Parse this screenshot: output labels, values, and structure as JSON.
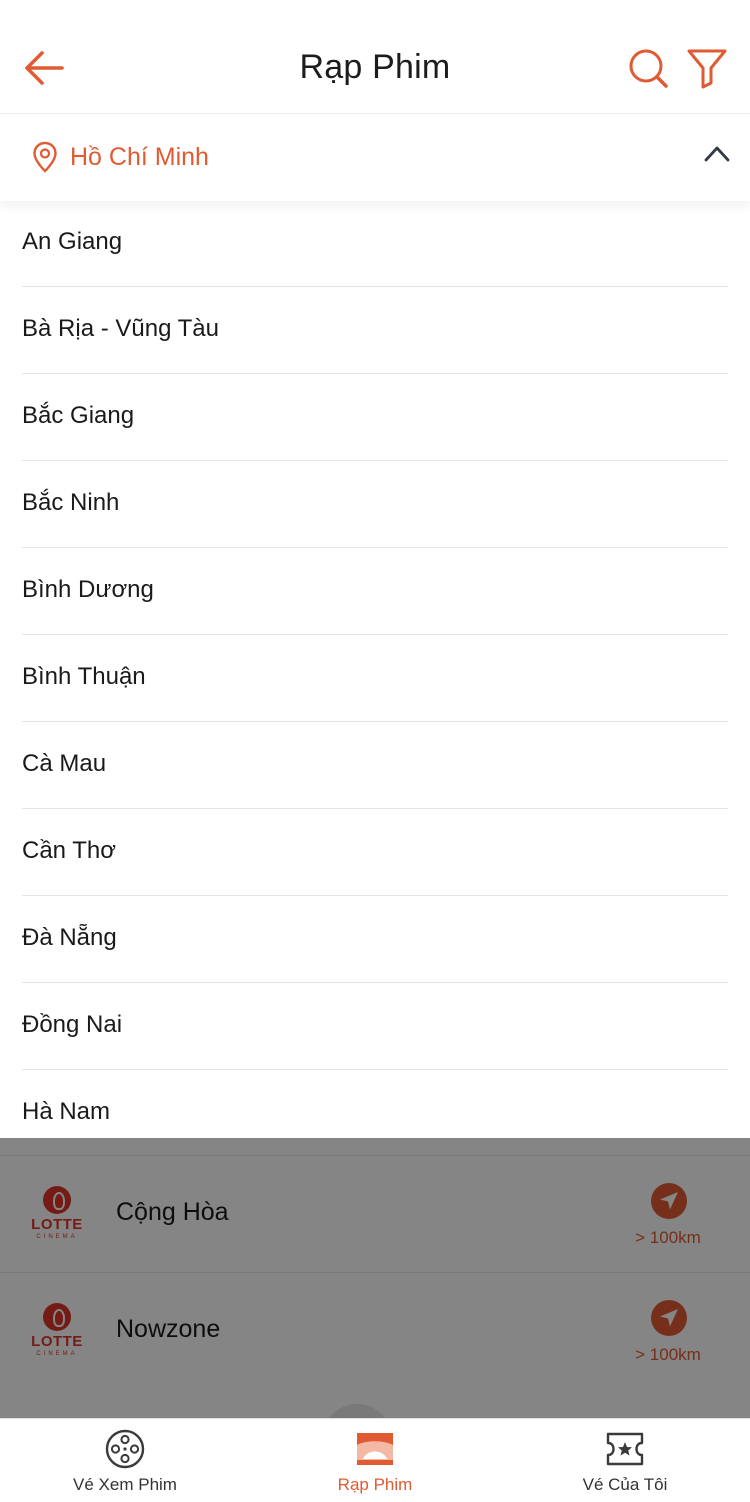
{
  "header": {
    "title": "Rạp Phim",
    "back_icon": "arrow-left-icon",
    "search_icon": "search-icon",
    "filter_icon": "filter-icon",
    "accent_color": "#e05a32"
  },
  "city_selector": {
    "selected_city": "Hồ Chí Minh",
    "icon": "location-pin-icon",
    "expanded": true
  },
  "province_list": [
    "An Giang",
    "Bà Rịa - Vũng Tàu",
    "Bắc Giang",
    "Bắc Ninh",
    "Bình Dương",
    "Bình Thuận",
    "Cà Mau",
    "Cần Thơ",
    "Đà Nẵng",
    "Đồng Nai",
    "Hà Nam"
  ],
  "cinemas": [
    {
      "brand": "LOTTE",
      "brand_sub": "CINEMA",
      "name": "Cộng Hòa",
      "distance": "> 100km"
    },
    {
      "brand": "LOTTE",
      "brand_sub": "CINEMA",
      "name": "Nowzone",
      "distance": "> 100km"
    }
  ],
  "tabbar": {
    "tabs": [
      {
        "label": "Vé Xem Phim",
        "icon": "film-reel-icon",
        "active": false
      },
      {
        "label": "Rạp Phim",
        "icon": "theater-icon",
        "active": true
      },
      {
        "label": "Vé Của Tôi",
        "icon": "ticket-star-icon",
        "active": false
      }
    ],
    "active_color": "#e05a32"
  }
}
